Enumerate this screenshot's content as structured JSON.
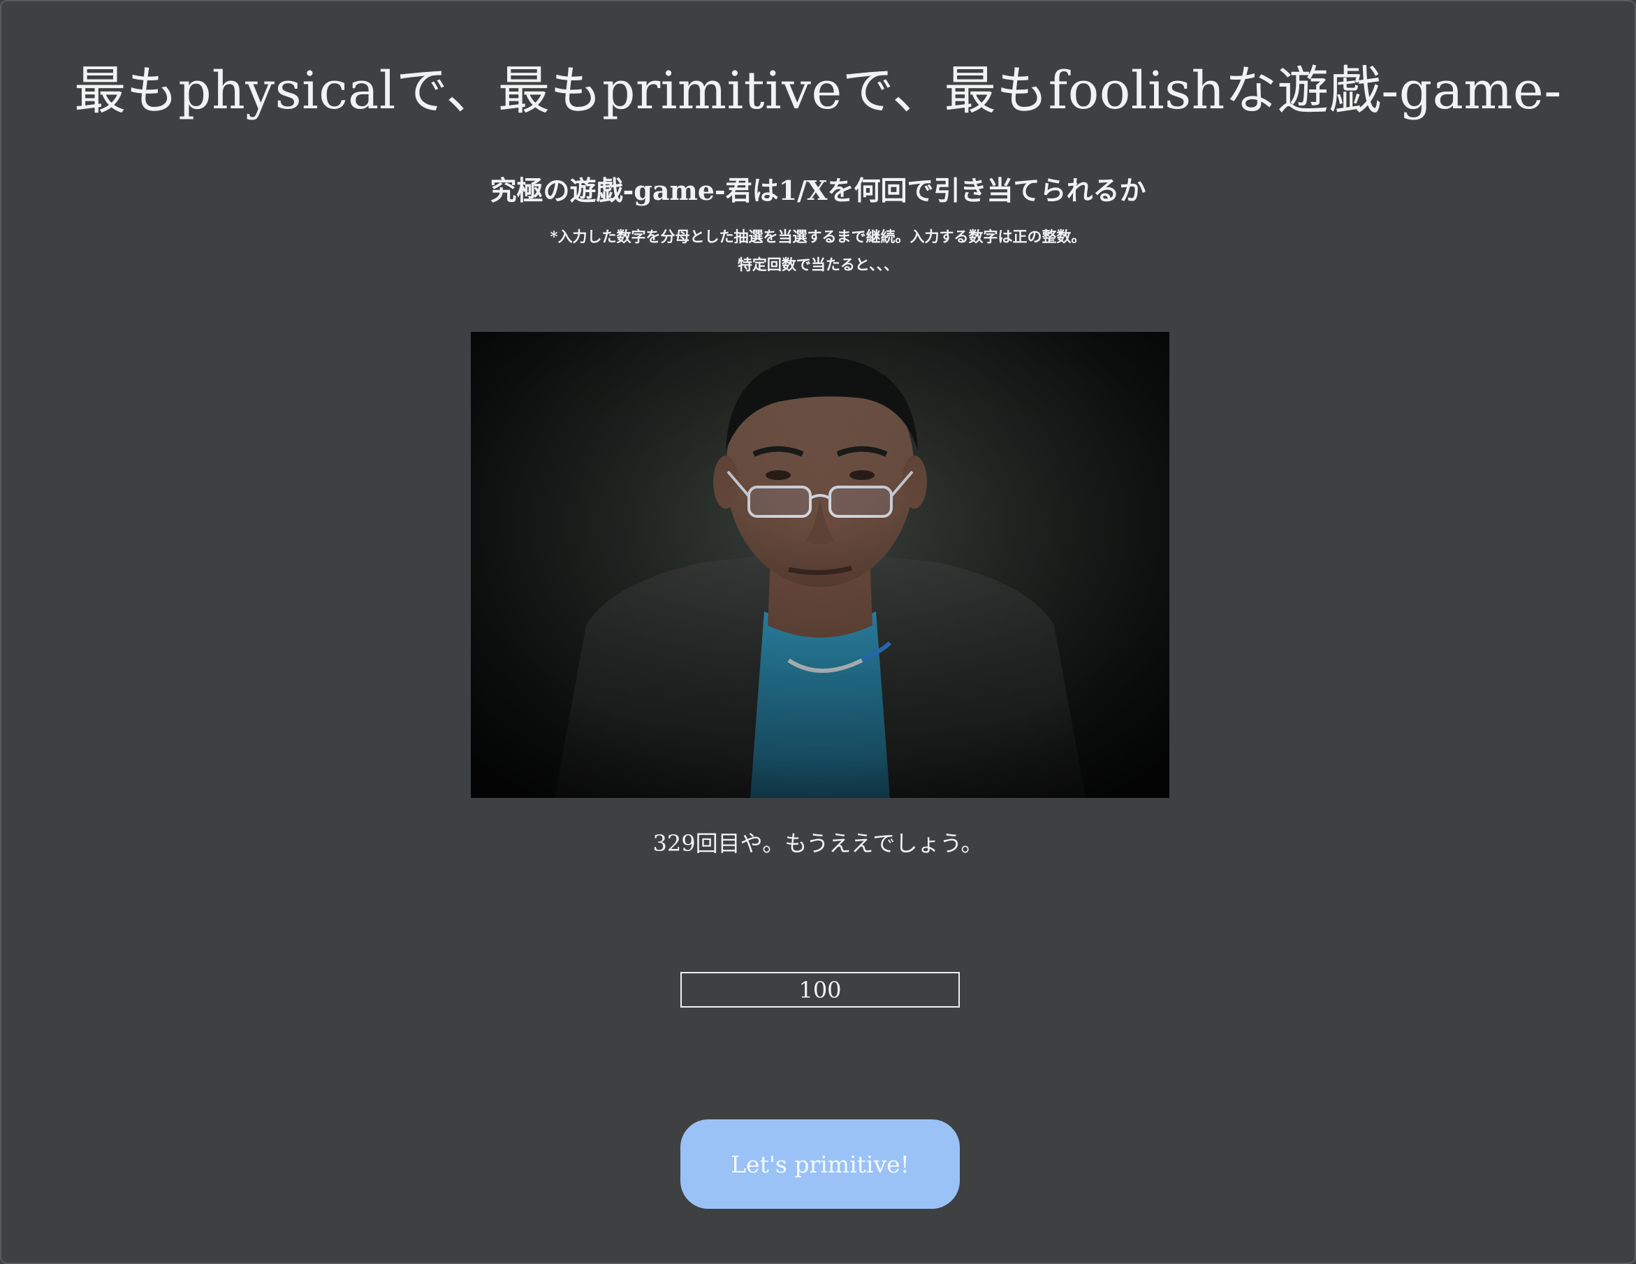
{
  "page": {
    "title": "最もphysicalで、最もprimitiveで、最もfoolishな遊戯-game-",
    "subtitle": "究極の遊戯-game-君は1/Xを何回で引き当てられるか",
    "note_line1": "*入力した数字を分母とした抽選を当選するまで継続。入力する数字は正の整数。",
    "note_line2": "特定回数で当たると、、、"
  },
  "result": {
    "message": "329回目や。もうええでしょう。"
  },
  "form": {
    "denominator_value": "100",
    "submit_label": "Let's primitive!"
  },
  "colors": {
    "background": "#3e4041",
    "button": "#9ac2f7",
    "text": "#f2f2f2"
  }
}
